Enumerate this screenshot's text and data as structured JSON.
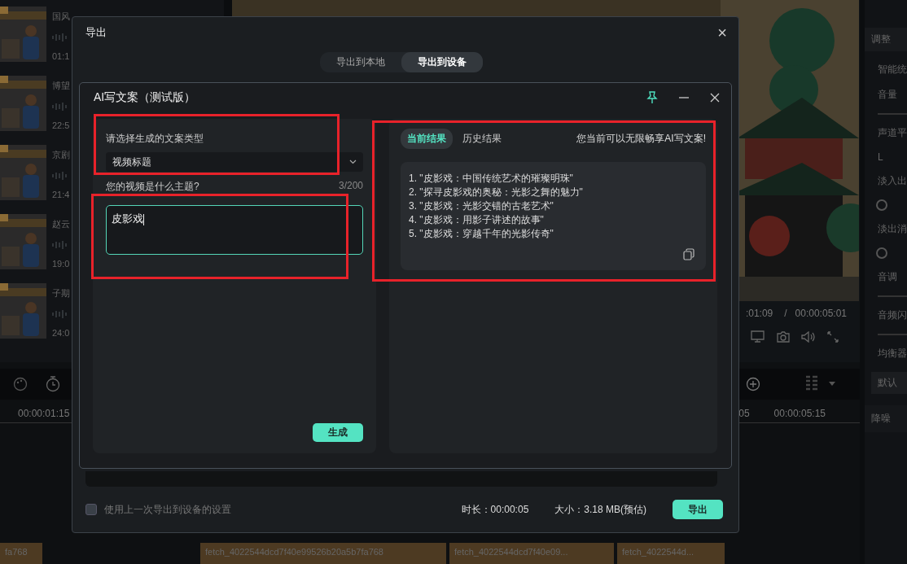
{
  "media_list": [
    {
      "title": "国风",
      "duration": "01:1"
    },
    {
      "title": "博望",
      "duration": "22:5"
    },
    {
      "title": "京剧",
      "duration": "21:4"
    },
    {
      "title": "赵云",
      "duration": "19:0"
    },
    {
      "title": "子期",
      "duration": "24:0"
    }
  ],
  "preview": {
    "current_time": ":01:09",
    "separator": "/",
    "total_time": "00:00:05:01"
  },
  "timeline": {
    "ruler": [
      "00:00:01:15",
      "05",
      "00:00:05:15"
    ],
    "clips": [
      "fa768",
      "fetch_4022544dcd7f40e99526b20a5b7fa768",
      "fetch_4022544dcd7f40e09...",
      "fetch_4022544d..."
    ]
  },
  "right_panel": {
    "header": "调整",
    "items": [
      {
        "kind": "label",
        "text": "智能统"
      },
      {
        "kind": "label",
        "text": "音量"
      },
      {
        "kind": "slider"
      },
      {
        "kind": "label",
        "text": "声道平"
      },
      {
        "kind": "label",
        "text": "L"
      },
      {
        "kind": "label",
        "text": "淡入出"
      },
      {
        "kind": "knob"
      },
      {
        "kind": "label",
        "text": "淡出消"
      },
      {
        "kind": "knob"
      },
      {
        "kind": "label",
        "text": "音调"
      },
      {
        "kind": "slider"
      },
      {
        "kind": "label",
        "text": "音频闪"
      },
      {
        "kind": "slider"
      },
      {
        "kind": "label",
        "text": "均衡器"
      },
      {
        "kind": "select",
        "text": "默认"
      },
      {
        "kind": "section",
        "text": "降噪"
      }
    ]
  },
  "export_dialog": {
    "title": "导出",
    "close": "×",
    "tabs": [
      {
        "label": "导出到本地",
        "selected": false
      },
      {
        "label": "导出到设备",
        "selected": true
      }
    ],
    "use_last_settings": {
      "label": "使用上一次导出到设备的设置",
      "checked": false
    },
    "duration": "时长：00:00:05",
    "size": "大小：3.18 MB(预估)",
    "export_button": "导出"
  },
  "ai_dialog": {
    "title": "AI写文案（测试版）",
    "type_label": "请选择生成的文案类型",
    "type_value": "视频标题",
    "topic_label": "您的视频是什么主题?",
    "topic_count": "3/200",
    "topic_value": "皮影戏",
    "generate_button": "生成",
    "result_tabs": [
      {
        "label": "当前结果",
        "selected": true
      },
      {
        "label": "历史结果",
        "selected": false
      }
    ],
    "notice": "您当前可以无限畅享AI写文案!",
    "results": [
      "1. \"皮影戏：中国传统艺术的璀璨明珠\"",
      "2. \"探寻皮影戏的奥秘：光影之舞的魅力\"",
      "3. \"皮影戏：光影交错的古老艺术\"",
      "4. \"皮影戏：用影子讲述的故事\"",
      "5. \"皮影戏：穿越千年的光影传奇\""
    ]
  }
}
